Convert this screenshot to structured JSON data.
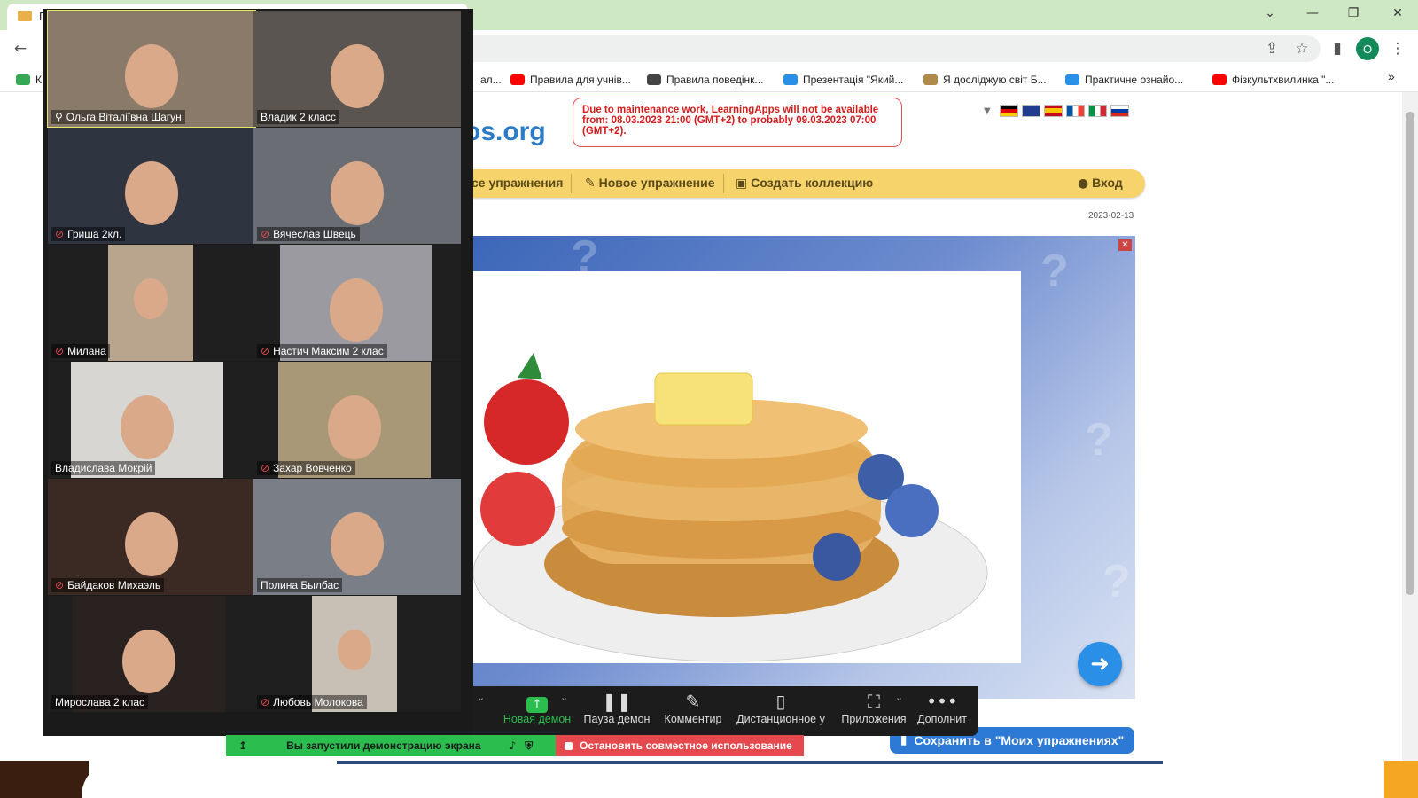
{
  "browser": {
    "tab_fragment": "П",
    "window_controls": {
      "tab_search": "⌄",
      "minimize": "—",
      "restore": "❐",
      "close": "✕"
    },
    "avatar_letter": "O",
    "bookmarks": [
      {
        "label": "К",
        "icon": "maps-icon",
        "color": "#34a853"
      },
      {
        "label": "ал...",
        "icon": "folder-icon",
        "color": "#ffffff"
      },
      {
        "label": "Правила для учнів...",
        "icon": "youtube-icon",
        "color": "#ff0000"
      },
      {
        "label": "Правила поведінк...",
        "icon": "document-icon",
        "color": "#444444"
      },
      {
        "label": "Презентація \"Який...",
        "icon": "snowflake-icon",
        "color": "#2a8fe6"
      },
      {
        "label": "Я досліджую світ Б...",
        "icon": "book-icon",
        "color": "#b08a4a"
      },
      {
        "label": "Практичне ознайо...",
        "icon": "snowflake-icon",
        "color": "#2a8fe6"
      },
      {
        "label": "Фізкультхвилинка \"...",
        "icon": "youtube-icon",
        "color": "#ff0000"
      }
    ],
    "more_bookmarks": "»"
  },
  "site": {
    "logo_fragment": "os.org",
    "notice": "Due to maintenance work, LearningApps will not be available from: 08.03.2023 21:00 (GMT+2) to probably 09.03.2023 07:00 (GMT+2).",
    "nav": {
      "all_exercises": "се упражнения",
      "new_exercise": "Новое упражнение",
      "create_collection": "Создать коллекцию",
      "login": "Вход"
    },
    "date": "2023-02-13",
    "save_button": "Сохранить в \"Моих упражнениях\"",
    "next_arrow": "➜"
  },
  "participants": [
    {
      "name": "Ольга Віталіївна Шагун",
      "muted": false,
      "pinned": true,
      "speaking": true,
      "bg": "#8a7a6a"
    },
    {
      "name": "Владик 2 класс",
      "muted": false,
      "pinned": false,
      "speaking": false,
      "bg": "#5a5550"
    },
    {
      "name": "Гриша 2кл.",
      "muted": true,
      "pinned": false,
      "speaking": false,
      "bg": "#2e3440"
    },
    {
      "name": "Вячеслав Швець",
      "muted": true,
      "pinned": false,
      "speaking": false,
      "bg": "#6a6e74"
    },
    {
      "name": "Милана",
      "muted": true,
      "pinned": false,
      "speaking": false,
      "bg": "#b9a48e"
    },
    {
      "name": "Настич Максим 2 клас",
      "muted": true,
      "pinned": false,
      "speaking": false,
      "bg": "#9a9aa0"
    },
    {
      "name": "Владислава Мокрій",
      "muted": false,
      "pinned": false,
      "speaking": false,
      "bg": "#d8d6d2"
    },
    {
      "name": "Захар Вовченко",
      "muted": true,
      "pinned": false,
      "speaking": false,
      "bg": "#a89878"
    },
    {
      "name": "Байдаков Михаэль",
      "muted": true,
      "pinned": false,
      "speaking": false,
      "bg": "#3b2a24"
    },
    {
      "name": "Полина Былбас",
      "muted": false,
      "pinned": false,
      "speaking": false,
      "bg": "#7a7e86"
    },
    {
      "name": "Мирослава 2 клас",
      "muted": false,
      "pinned": false,
      "speaking": false,
      "bg": "#2a2220"
    },
    {
      "name": "Любовь Молокова",
      "muted": true,
      "pinned": false,
      "speaking": false,
      "bg": "#c8c0b4"
    }
  ],
  "zoom_toolbar": {
    "new_share": "Новая демон",
    "pause_share": "Пауза демон",
    "annotate": "Комментир",
    "remote_control": "Дистанционное у",
    "apps": "Приложения",
    "more": "Дополнит"
  },
  "share_banner": {
    "status": "Вы запустили демонстрацию экрана",
    "stop": "Остановить совместное использование"
  }
}
